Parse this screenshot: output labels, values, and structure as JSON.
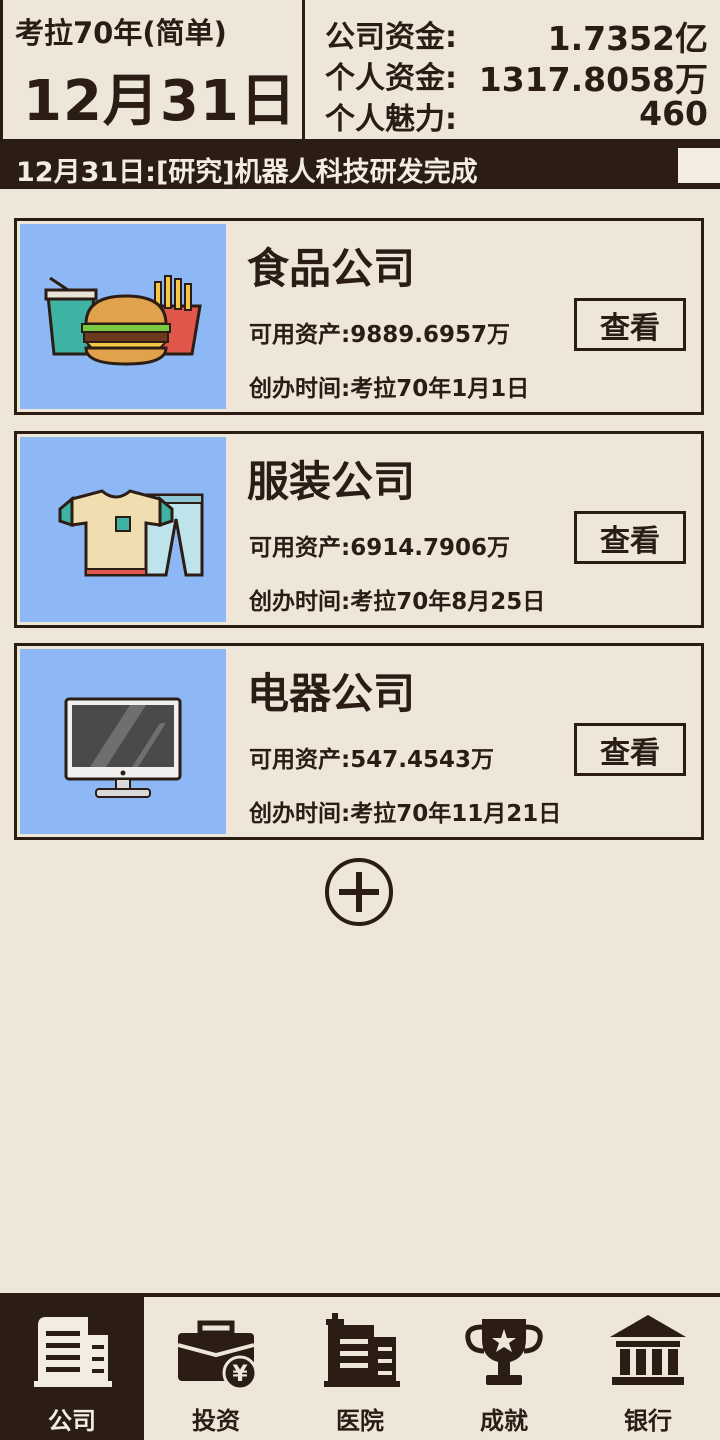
{
  "header": {
    "year_mode": "考拉70年(简单)",
    "date": "12月31日",
    "finances": [
      {
        "label": "公司资金:",
        "value": "1.7352亿"
      },
      {
        "label": "个人资金:",
        "value": "1317.8058万"
      },
      {
        "label": "个人魅力:",
        "value": "460"
      }
    ]
  },
  "ticker": {
    "text": "12月31日:[研究]机器人科技研发完成"
  },
  "companies": [
    {
      "name": "食品公司",
      "assets": "可用资产:9889.6957万",
      "founded": "创办时间:考拉70年1月1日",
      "button": "查看",
      "icon": "burger-fries-icon"
    },
    {
      "name": "服装公司",
      "assets": "可用资产:6914.7906万",
      "founded": "创办时间:考拉70年8月25日",
      "button": "查看",
      "icon": "shirt-pants-icon"
    },
    {
      "name": "电器公司",
      "assets": "可用资产:547.4543万",
      "founded": "创办时间:考拉70年11月21日",
      "button": "查看",
      "icon": "computer-monitor-icon"
    }
  ],
  "nav": {
    "items": [
      {
        "label": "公司",
        "icon": "company-building-icon",
        "active": true
      },
      {
        "label": "投资",
        "icon": "briefcase-yen-icon",
        "active": false
      },
      {
        "label": "医院",
        "icon": "hospital-icon",
        "active": false
      },
      {
        "label": "成就",
        "icon": "trophy-icon",
        "active": false
      },
      {
        "label": "银行",
        "icon": "bank-icon",
        "active": false
      }
    ]
  },
  "colors": {
    "background": "#ede6d9",
    "ink": "#2b1d14",
    "card_image_bg": "#8db8f5",
    "ticker_text": "#f3ece0"
  }
}
